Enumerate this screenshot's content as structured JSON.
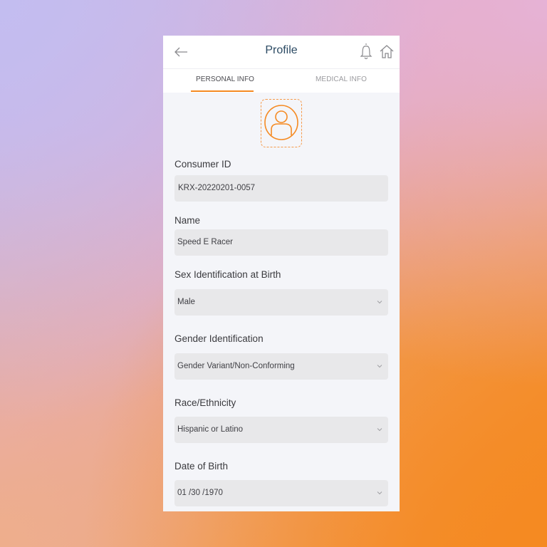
{
  "header": {
    "title": "Profile",
    "back_icon": "arrow-left-icon",
    "notification_icon": "bell-icon",
    "home_icon": "home-icon"
  },
  "tabs": [
    {
      "label": "PERSONAL INFO",
      "active": true
    },
    {
      "label": "MEDICAL INFO",
      "active": false
    }
  ],
  "avatar": {
    "icon": "user-circle-icon"
  },
  "fields": [
    {
      "label": "Consumer ID",
      "value": "KRX-20220201-0057",
      "type": "text"
    },
    {
      "label": "Name",
      "value": "Speed E Racer",
      "type": "text"
    },
    {
      "label": "Sex Identification at Birth",
      "value": "Male",
      "type": "select"
    },
    {
      "label": "Gender Identification",
      "value": "Gender Variant/Non-Conforming",
      "type": "select"
    },
    {
      "label": "Race/Ethnicity",
      "value": "Hispanic or Latino",
      "type": "select"
    },
    {
      "label": "Date of Birth",
      "value": "01 /30 /1970",
      "type": "select"
    }
  ],
  "colors": {
    "accent": "#f58a22",
    "title": "#2b4a63",
    "field_bg": "#e8e8ea",
    "page_bg": "#f4f5f9"
  }
}
